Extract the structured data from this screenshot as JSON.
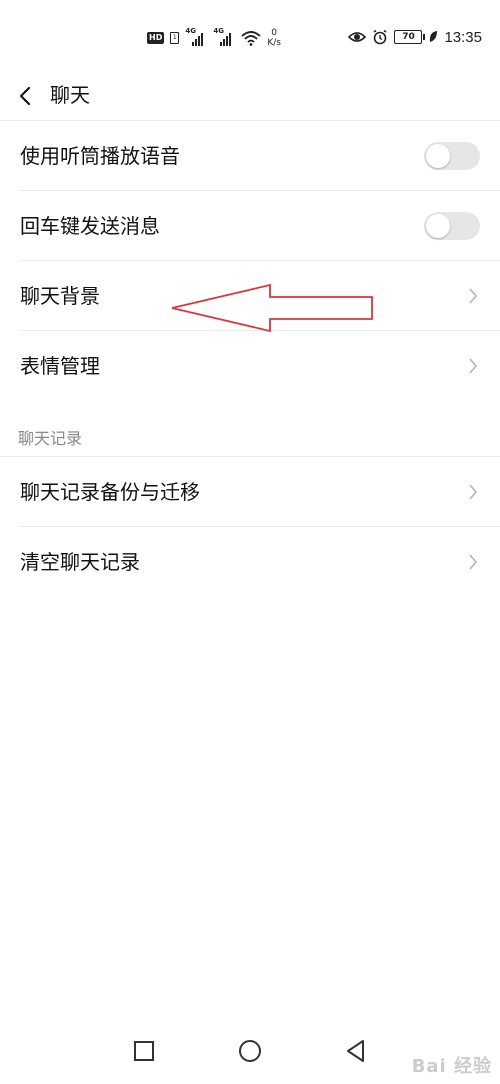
{
  "status_bar": {
    "hd_label": "HD",
    "sim_label": "1",
    "network_1": "4G",
    "network_2": "4G",
    "speed_value": "0",
    "speed_unit": "K/s",
    "battery_level": "70",
    "time": "13:35"
  },
  "header": {
    "title": "聊天"
  },
  "settings": {
    "rows": [
      {
        "label": "使用听筒播放语音",
        "control": "toggle",
        "enabled": false
      },
      {
        "label": "回车键发送消息",
        "control": "toggle",
        "enabled": false
      },
      {
        "label": "聊天背景",
        "control": "chevron"
      },
      {
        "label": "表情管理",
        "control": "chevron"
      }
    ]
  },
  "history": {
    "section_title": "聊天记录",
    "rows": [
      {
        "label": "聊天记录备份与迁移",
        "control": "chevron"
      },
      {
        "label": "清空聊天记录",
        "control": "chevron"
      }
    ]
  },
  "annotation": {
    "color": "#d9363e",
    "points_to": "聊天背景"
  },
  "nav": {
    "icons": [
      "square-recents-icon",
      "circle-home-icon",
      "triangle-back-icon"
    ]
  },
  "watermark": "Bai 经验",
  "colors": {
    "toggle_off": "#e6e6e6",
    "divider": "#ececec",
    "section_text": "#888888"
  }
}
